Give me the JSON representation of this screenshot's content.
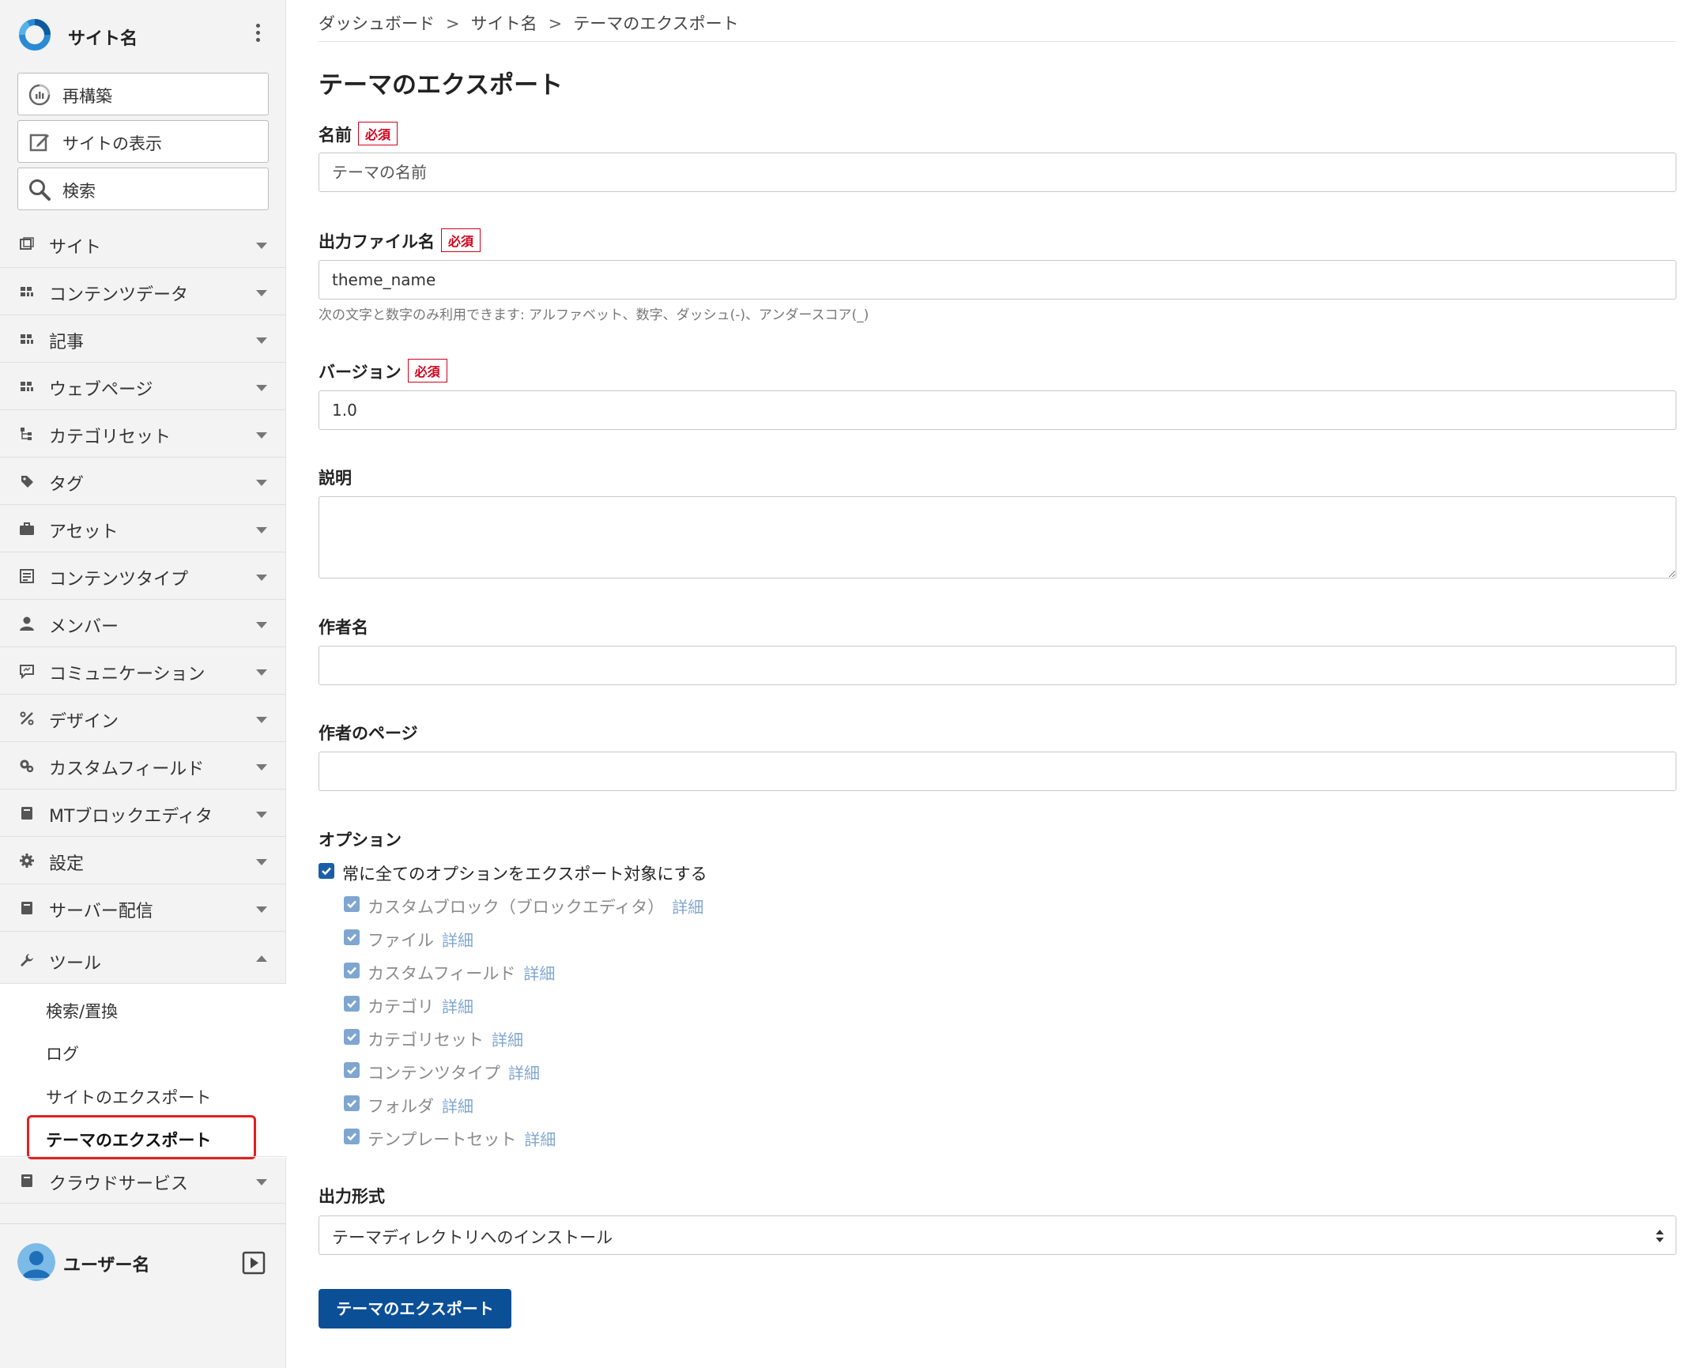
{
  "sidebar": {
    "site_name": "サイト名",
    "actions": [
      {
        "label": "再構築",
        "icon": "rebuild-icon"
      },
      {
        "label": "サイトの表示",
        "icon": "edit-icon"
      },
      {
        "label": "検索",
        "icon": "search-icon"
      }
    ],
    "nav": [
      {
        "label": "サイト",
        "icon": "site-icon"
      },
      {
        "label": "コンテンツデータ",
        "icon": "content-data-icon"
      },
      {
        "label": "記事",
        "icon": "entry-icon"
      },
      {
        "label": "ウェブページ",
        "icon": "webpage-icon"
      },
      {
        "label": "カテゴリセット",
        "icon": "category-set-icon"
      },
      {
        "label": "タグ",
        "icon": "tag-icon"
      },
      {
        "label": "アセット",
        "icon": "asset-icon"
      },
      {
        "label": "コンテンツタイプ",
        "icon": "content-type-icon"
      },
      {
        "label": "メンバー",
        "icon": "member-icon"
      },
      {
        "label": "コミュニケーション",
        "icon": "communication-icon"
      },
      {
        "label": "デザイン",
        "icon": "design-icon"
      },
      {
        "label": "カスタムフィールド",
        "icon": "custom-field-icon"
      },
      {
        "label": "MTブロックエディタ",
        "icon": "block-editor-icon"
      },
      {
        "label": "設定",
        "icon": "settings-icon"
      },
      {
        "label": "サーバー配信",
        "icon": "server-sync-icon"
      },
      {
        "label": "ツール",
        "icon": "wrench-icon"
      }
    ],
    "tools_sub": [
      "検索/置換",
      "ログ",
      "サイトのエクスポート",
      "テーマのエクスポート"
    ],
    "cloud": {
      "label": "クラウドサービス",
      "icon": "cloud-service-icon"
    },
    "user_name": "ユーザー名"
  },
  "breadcrumb": [
    "ダッシュボード",
    "サイト名",
    "テーマのエクスポート"
  ],
  "breadcrumb_sep": ">",
  "page_title": "テーマのエクスポート",
  "required_label": "必須",
  "form": {
    "name": {
      "label": "名前",
      "placeholder": "テーマの名前"
    },
    "filename": {
      "label": "出力ファイル名",
      "value": "theme_name",
      "hint": "次の文字と数字のみ利用できます: アルファベット、数字、ダッシュ(-)、アンダースコア(_)"
    },
    "version": {
      "label": "バージョン",
      "value": "1.0"
    },
    "description": {
      "label": "説明",
      "value": ""
    },
    "author": {
      "label": "作者名",
      "value": ""
    },
    "author_page": {
      "label": "作者のページ",
      "value": ""
    },
    "options": {
      "label": "オプション",
      "all_label": "常に全てのオプションをエクスポート対象にする",
      "detail_label": "詳細",
      "items": [
        "カスタムブロック（ブロックエディタ）",
        "ファイル",
        "カスタムフィールド",
        "カテゴリ",
        "カテゴリセット",
        "コンテンツタイプ",
        "フォルダ",
        "テンプレートセット"
      ]
    },
    "output": {
      "label": "出力形式",
      "value": "テーマディレクトリへのインストール"
    },
    "submit_label": "テーマのエクスポート"
  },
  "colors": {
    "primary": "#0b4f97",
    "required": "#d0021b",
    "highlight": "#e02020",
    "sidebar_bg": "#f3f3f3"
  }
}
